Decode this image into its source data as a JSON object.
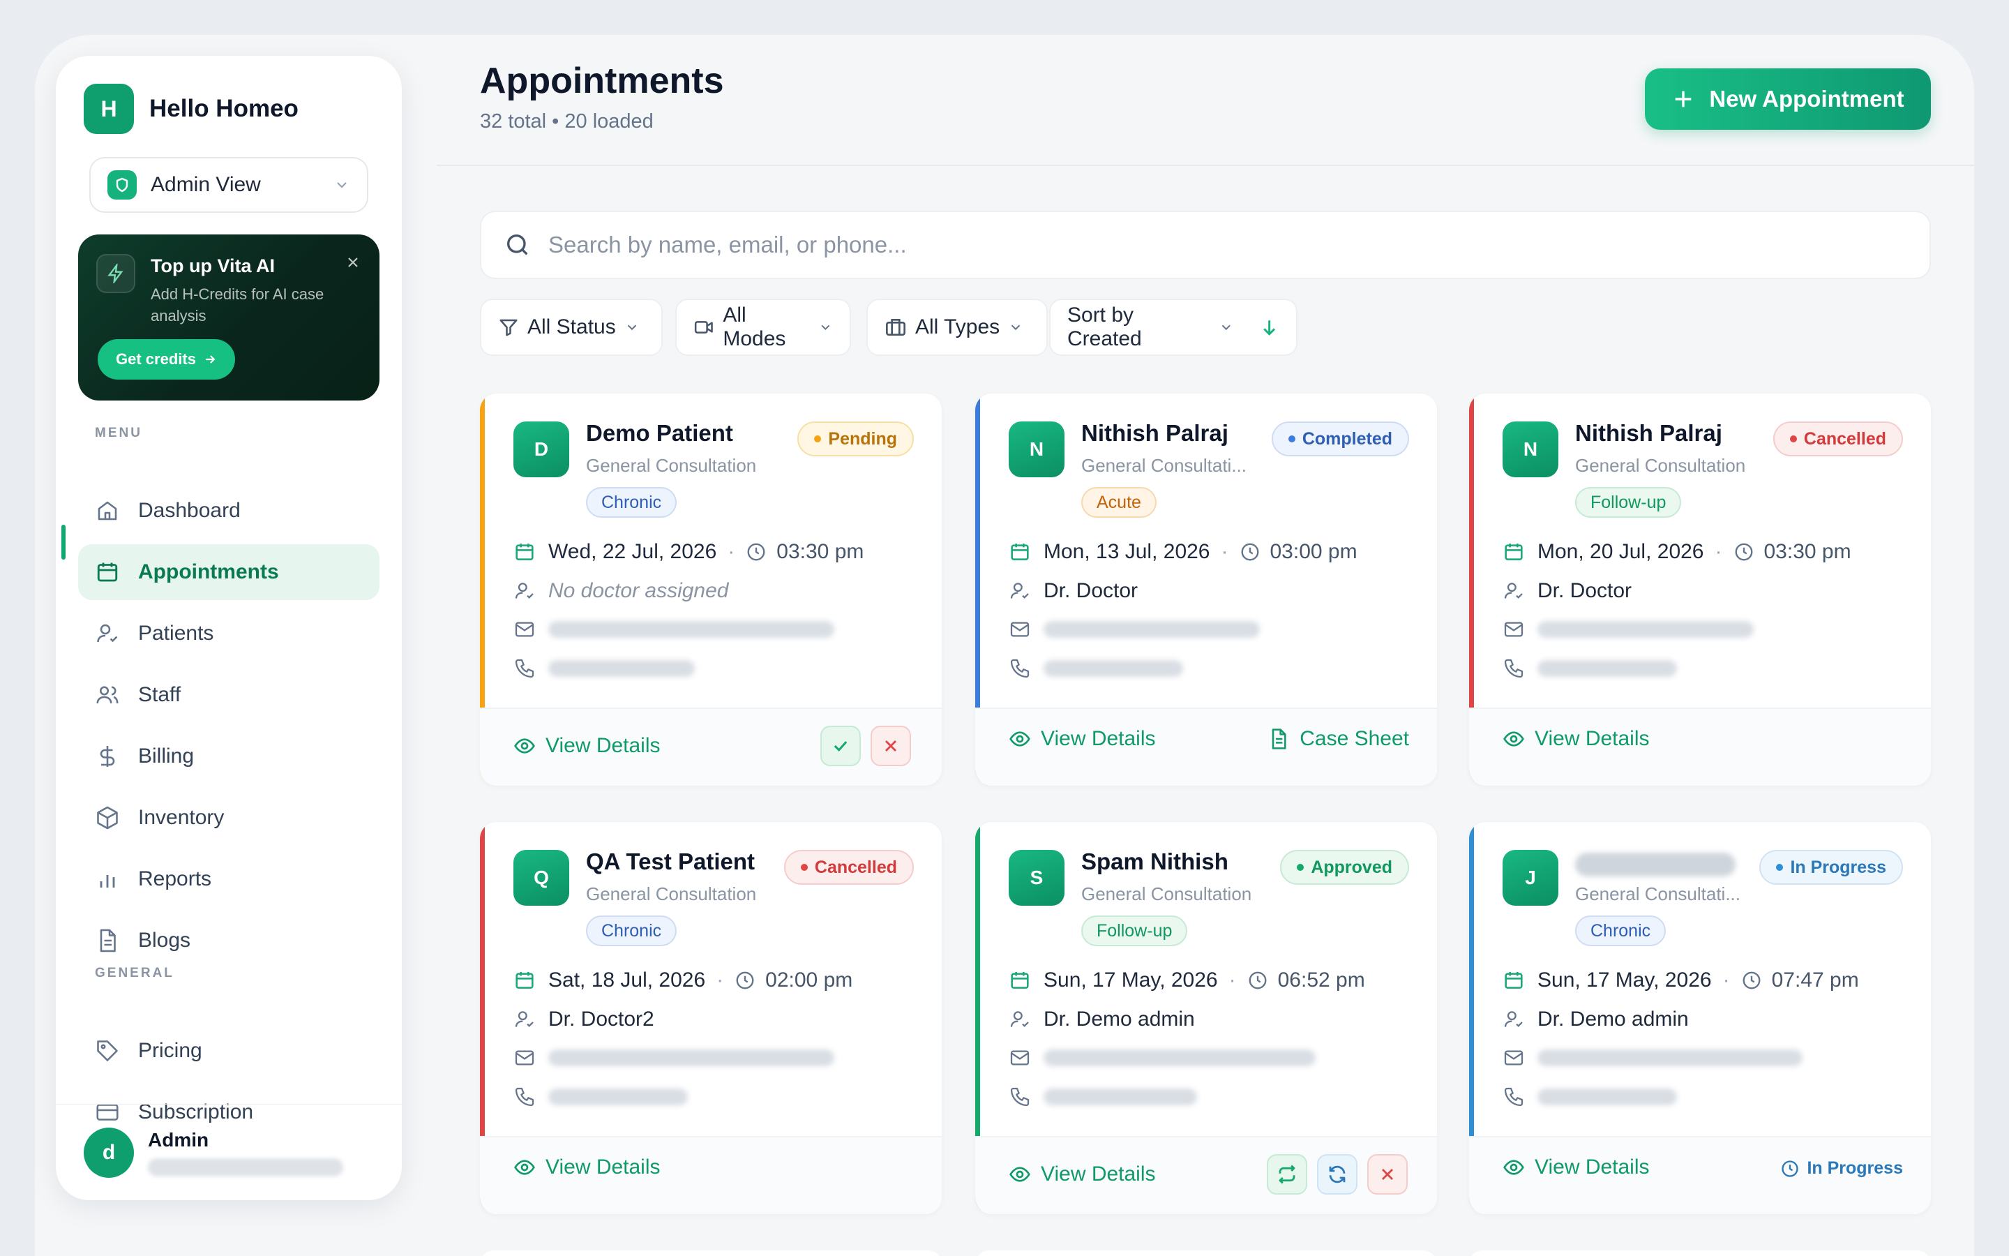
{
  "app": {
    "name": "Hello Homeo",
    "logo_letter": "H"
  },
  "view_select": {
    "label": "Admin View"
  },
  "promo": {
    "title": "Top up Vita AI",
    "subtitle": "Add H-Credits for AI case analysis",
    "button": "Get credits"
  },
  "menu": {
    "heading": "MENU",
    "items": [
      {
        "label": "Dashboard",
        "icon": "home-icon"
      },
      {
        "label": "Appointments",
        "icon": "calendar-icon",
        "active": true
      },
      {
        "label": "Patients",
        "icon": "user-check-icon"
      },
      {
        "label": "Staff",
        "icon": "users-icon"
      },
      {
        "label": "Billing",
        "icon": "dollar-icon"
      },
      {
        "label": "Inventory",
        "icon": "box-icon"
      },
      {
        "label": "Reports",
        "icon": "bar-chart-icon"
      },
      {
        "label": "Blogs",
        "icon": "document-icon"
      }
    ]
  },
  "general": {
    "heading": "GENERAL",
    "items": [
      {
        "label": "Pricing",
        "icon": "tag-icon"
      },
      {
        "label": "Subscription",
        "icon": "credit-card-icon"
      }
    ]
  },
  "user": {
    "avatar_letter": "d",
    "name": "Admin"
  },
  "header": {
    "title": "Appointments",
    "subtitle": "32 total • 20 loaded",
    "new_button": "New Appointment"
  },
  "search": {
    "placeholder": "Search by name, email, or phone..."
  },
  "filters": {
    "status": "All Status",
    "modes": "All Modes",
    "types": "All Types",
    "sort": "Sort by Created"
  },
  "common": {
    "view_details": "View Details",
    "case_sheet": "Case Sheet",
    "in_progress": "In Progress"
  },
  "appointments": [
    {
      "initial": "D",
      "name": "Demo Patient",
      "service": "General Consultation",
      "type": "Chronic",
      "status": "Pending",
      "date": "Wed, 22 Jul, 2026",
      "time": "03:30 pm",
      "doctor": "No doctor assigned",
      "accent": "#f5a310"
    },
    {
      "initial": "N",
      "name": "Nithish Palraj",
      "service": "General Consultati...",
      "type": "Acute",
      "status": "Completed",
      "date": "Mon, 13 Jul, 2026",
      "time": "03:00 pm",
      "doctor": "Dr. Doctor",
      "accent": "#3b7ddd"
    },
    {
      "initial": "N",
      "name": "Nithish Palraj",
      "service": "General Consultation",
      "type": "Follow-up",
      "status": "Cancelled",
      "date": "Mon, 20 Jul, 2026",
      "time": "03:30 pm",
      "doctor": "Dr. Doctor",
      "accent": "#e04545"
    },
    {
      "initial": "Q",
      "name": "QA Test Patient",
      "service": "General Consultation",
      "type": "Chronic",
      "status": "Cancelled",
      "date": "Sat, 18 Jul, 2026",
      "time": "02:00 pm",
      "doctor": "Dr. Doctor2",
      "accent": "#e04545"
    },
    {
      "initial": "S",
      "name": "Spam Nithish",
      "service": "General Consultation",
      "type": "Follow-up",
      "status": "Approved",
      "date": "Sun, 17 May, 2026",
      "time": "06:52 pm",
      "doctor": "Dr. Demo admin",
      "accent": "#14a86a"
    },
    {
      "initial": "J",
      "service": "General Consultati...",
      "type": "Chronic",
      "status": "In Progress",
      "date": "Sun, 17 May, 2026",
      "time": "07:47 pm",
      "doctor": "Dr. Demo admin",
      "accent": "#2d8fd6"
    }
  ],
  "colors": {
    "brand": "#0f9f6e",
    "accent_green": "#16c083",
    "link": "#0f9a68"
  }
}
